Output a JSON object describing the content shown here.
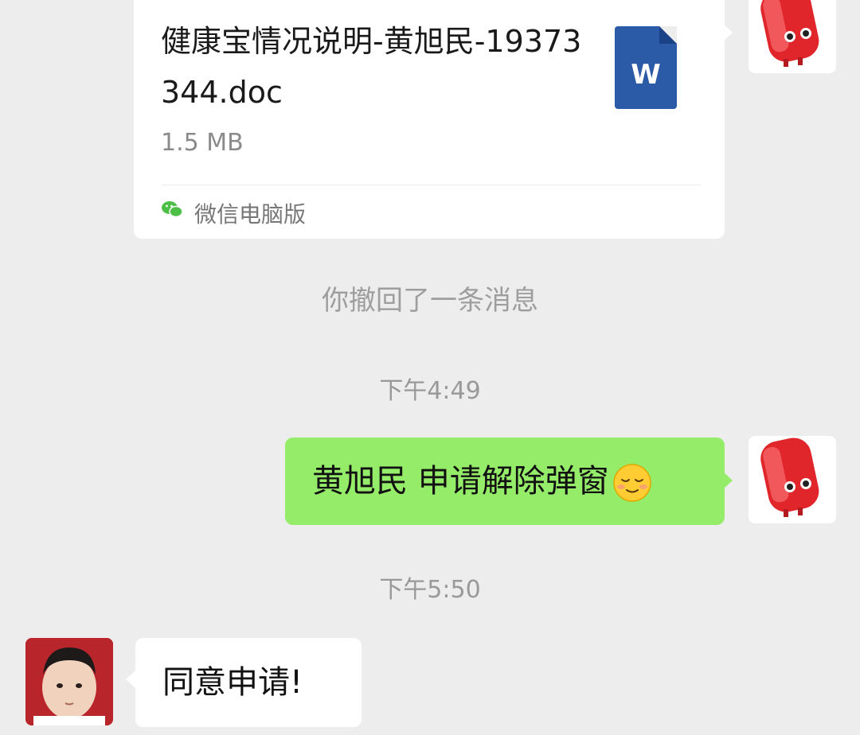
{
  "file_message": {
    "file_name": "健康宝情况说明-黄旭民-19373344.doc",
    "file_size": "1.5 MB",
    "file_type_letter": "W",
    "file_icon_name": "word-doc-icon",
    "source_label": "微信电脑版",
    "source_icon_name": "wechat-logo-icon"
  },
  "recall_notice": "你撤回了一条消息",
  "timestamps": [
    "下午4:49",
    "下午5:50"
  ],
  "sent_message": {
    "text": "黄旭民 申请解除弹窗",
    "emoji_name": "relieved-face-emoji"
  },
  "received_message": {
    "text": "同意申请!"
  },
  "colors": {
    "background": "#ededed",
    "sent_bubble": "#95ec69",
    "received_bubble": "#ffffff",
    "word_blue": "#2b5aa7"
  }
}
